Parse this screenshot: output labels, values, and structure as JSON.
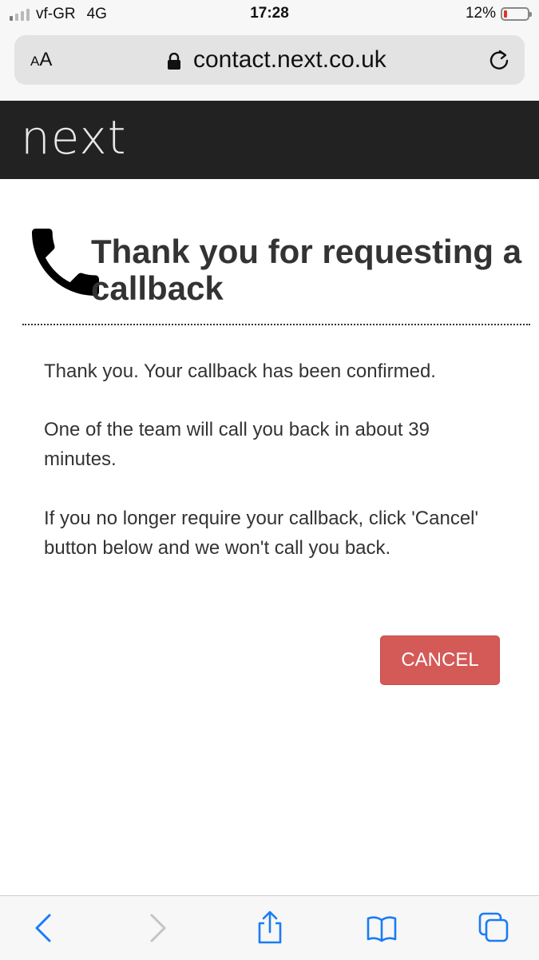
{
  "status_bar": {
    "carrier": "vf-GR",
    "network": "4G",
    "time": "17:28",
    "battery_percent": "12%",
    "battery_level": 0.12,
    "signal_bars_active": 1,
    "signal_bars_total": 4
  },
  "browser": {
    "text_size_label_small": "A",
    "text_size_label_large": "A",
    "url": "contact.next.co.uk"
  },
  "site": {
    "logo": "next"
  },
  "page": {
    "heading": "Thank you for requesting a callback",
    "paragraph_1": "Thank you. Your callback has been confirmed.",
    "paragraph_2": "One of the team will call you back in about 39 minutes.",
    "paragraph_3": "If you no longer require your callback, click 'Cancel' button below and we won't call you back.",
    "cancel_button": "CANCEL"
  },
  "colors": {
    "brand_bar": "#222222",
    "cancel_button": "#d45a57",
    "ios_blue": "#1a7cf5",
    "battery_low": "#e0322b"
  }
}
